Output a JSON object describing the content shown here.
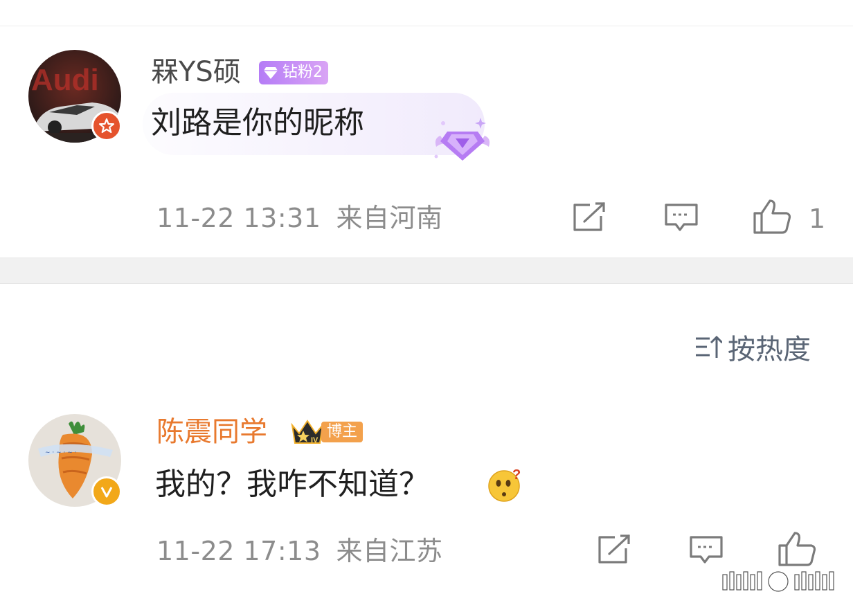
{
  "comments": [
    {
      "username": "槑YS硕",
      "fan_badge": "钻粉2",
      "text": "刘路是你的昵称",
      "time": "11-22 13:31",
      "location": "来自河南",
      "likes": "1"
    },
    {
      "username": "陈震同学",
      "blogger_badge": "博主",
      "text": "我的？我咋不知道？",
      "time": "11-22 17:13",
      "location": "来自江苏"
    }
  ],
  "sort": {
    "label": "按热度"
  },
  "colors": {
    "username_default": "#4a4a4a",
    "username_vip": "#e8792e",
    "meta": "#8c8c8c",
    "fan_badge": "#b57cf6",
    "blogger_tag": "#f3a14c"
  }
}
